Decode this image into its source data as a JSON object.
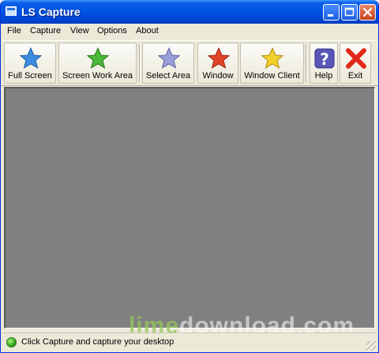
{
  "window": {
    "title": "LS Capture"
  },
  "menu": [
    "File",
    "Capture",
    "View",
    "Options",
    "About"
  ],
  "toolbar": [
    {
      "label": "Full Screen",
      "icon": "blue-star-icon",
      "color": "#3b8de0"
    },
    {
      "label": "Screen Work Area",
      "icon": "green-star-icon",
      "color": "#4cb83a"
    },
    {
      "label": "Select Area",
      "icon": "lavender-star-icon",
      "color": "#9a9ed8"
    },
    {
      "label": "Window",
      "icon": "red-star-icon",
      "color": "#e0452a"
    },
    {
      "label": "Window Client",
      "icon": "yellow-star-icon",
      "color": "#f2d02a"
    },
    {
      "label": "Help",
      "icon": "help-question-icon",
      "color": "#5a56b8"
    },
    {
      "label": "Exit",
      "icon": "red-x-icon",
      "color": "#e02a1a"
    }
  ],
  "status": {
    "text": "Click Capture and capture your desktop",
    "indicator_color": "#36a81a"
  },
  "watermark": {
    "part1": "lime",
    "part2": "download.com"
  }
}
